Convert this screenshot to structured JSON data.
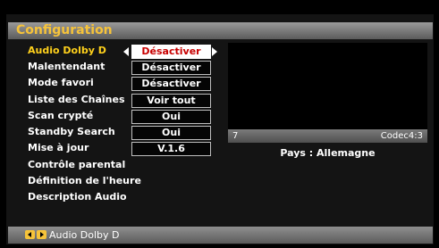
{
  "header": {
    "title": "Configuration"
  },
  "menu": {
    "items": [
      {
        "label": "Audio Dolby D",
        "value": "Désactiver"
      },
      {
        "label": "Malentendant",
        "value": "Désactiver"
      },
      {
        "label": "Mode favori",
        "value": "Désactiver"
      },
      {
        "label": "Liste des Chaînes",
        "value": "Voir tout"
      },
      {
        "label": "Scan crypté",
        "value": "Oui"
      },
      {
        "label": "Standby Search",
        "value": "Oui"
      },
      {
        "label": "Mise à jour",
        "value": "V.1.6"
      },
      {
        "label": "Contrôle parental"
      },
      {
        "label": "Définition de l'heure"
      },
      {
        "label": "Description Audio"
      }
    ],
    "selected_index": 0
  },
  "preview": {
    "channel_number": "7",
    "codec": "Codec4:3",
    "country": "Pays : Allemagne"
  },
  "footer": {
    "hint_label": "Audio Dolby D"
  },
  "colors": {
    "header_title": "#f6c33a",
    "selected_text": "#ffd11c",
    "selected_value_text": "#c80000"
  },
  "icons": [
    "left-arrow-icon",
    "right-arrow-icon",
    "left-key-icon",
    "right-key-icon"
  ]
}
